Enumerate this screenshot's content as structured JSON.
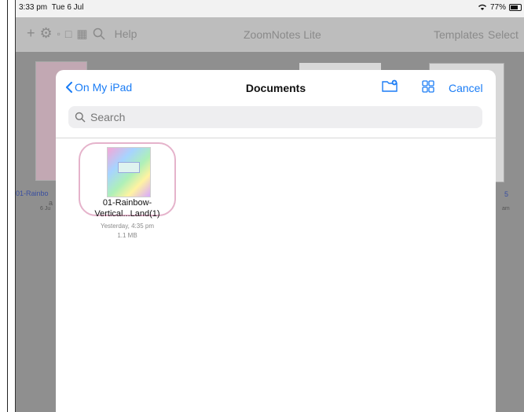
{
  "status": {
    "time": "3:33 pm",
    "date": "Tue 6 Jul",
    "battery": "77%"
  },
  "app": {
    "title": "ZoomNotes Lite",
    "help": "Help",
    "templates": "Templates",
    "select": "Select"
  },
  "background_files": {
    "left_label": "01-Rainbo",
    "left_sub1": "a",
    "left_sub2": "6 Ju",
    "right_label": "5",
    "right_sub": "am"
  },
  "modal": {
    "back_label": "On My iPad",
    "title": "Documents",
    "cancel_label": "Cancel",
    "search_placeholder": "Search"
  },
  "files": [
    {
      "name_line1": "01-Rainbow-",
      "name_line2": "Vertical...Land(1)",
      "date": "Yesterday, 4:35 pm",
      "size": "1.1 MB"
    }
  ],
  "colors": {
    "accent": "#1a7cf5",
    "highlight": "#e5b3cb",
    "overlay": "#8f8f8f"
  }
}
